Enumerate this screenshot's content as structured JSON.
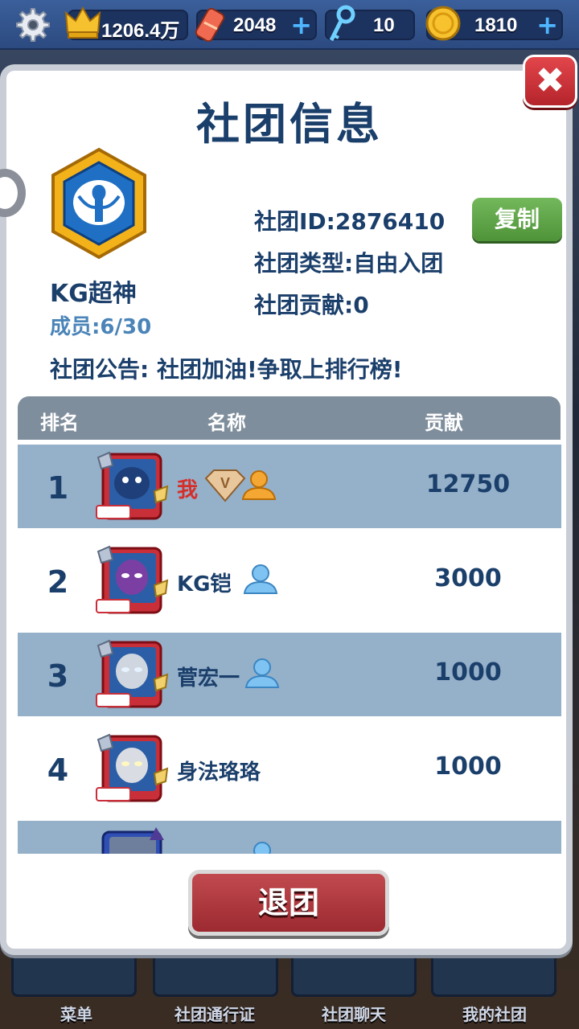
{
  "topbar": {
    "crown_value": "1206.4万",
    "ticket_value": "2048",
    "key_value": "10",
    "coin_value": "1810"
  },
  "colors": {
    "title": "#1b3f6b",
    "accent_red": "#d52f2a",
    "copy_green": "#5ea348",
    "row_shade": "#95b0c9"
  },
  "dialog": {
    "title": "社团信息",
    "close_icon": "close-icon",
    "club": {
      "name": "KG超神",
      "members": "成员:6/30",
      "id_line": "社团ID:2876410",
      "type_line": "社团类型:自由入团",
      "contrib_line": "社团贡献:0",
      "notice": "社团公告: 社团加油!争取上排行榜!"
    },
    "copy_label": "复制",
    "table": {
      "headers": {
        "rank": "排名",
        "name": "名称",
        "contrib": "贡献"
      },
      "rows": [
        {
          "rank": "1",
          "name": "我",
          "contrib": "12750",
          "badge": "diamond-v-icon",
          "role": "leader-icon"
        },
        {
          "rank": "2",
          "name": "KG铠",
          "contrib": "3000",
          "role": "member-icon"
        },
        {
          "rank": "3",
          "name": "菅宏一",
          "contrib": "1000",
          "role": "member-icon"
        },
        {
          "rank": "4",
          "name": "身法珞珞",
          "contrib": "1000"
        }
      ]
    },
    "quit_label": "退团"
  },
  "bottom_nav": [
    "菜单",
    "社团通行证",
    "社团聊天",
    "我的社团"
  ]
}
